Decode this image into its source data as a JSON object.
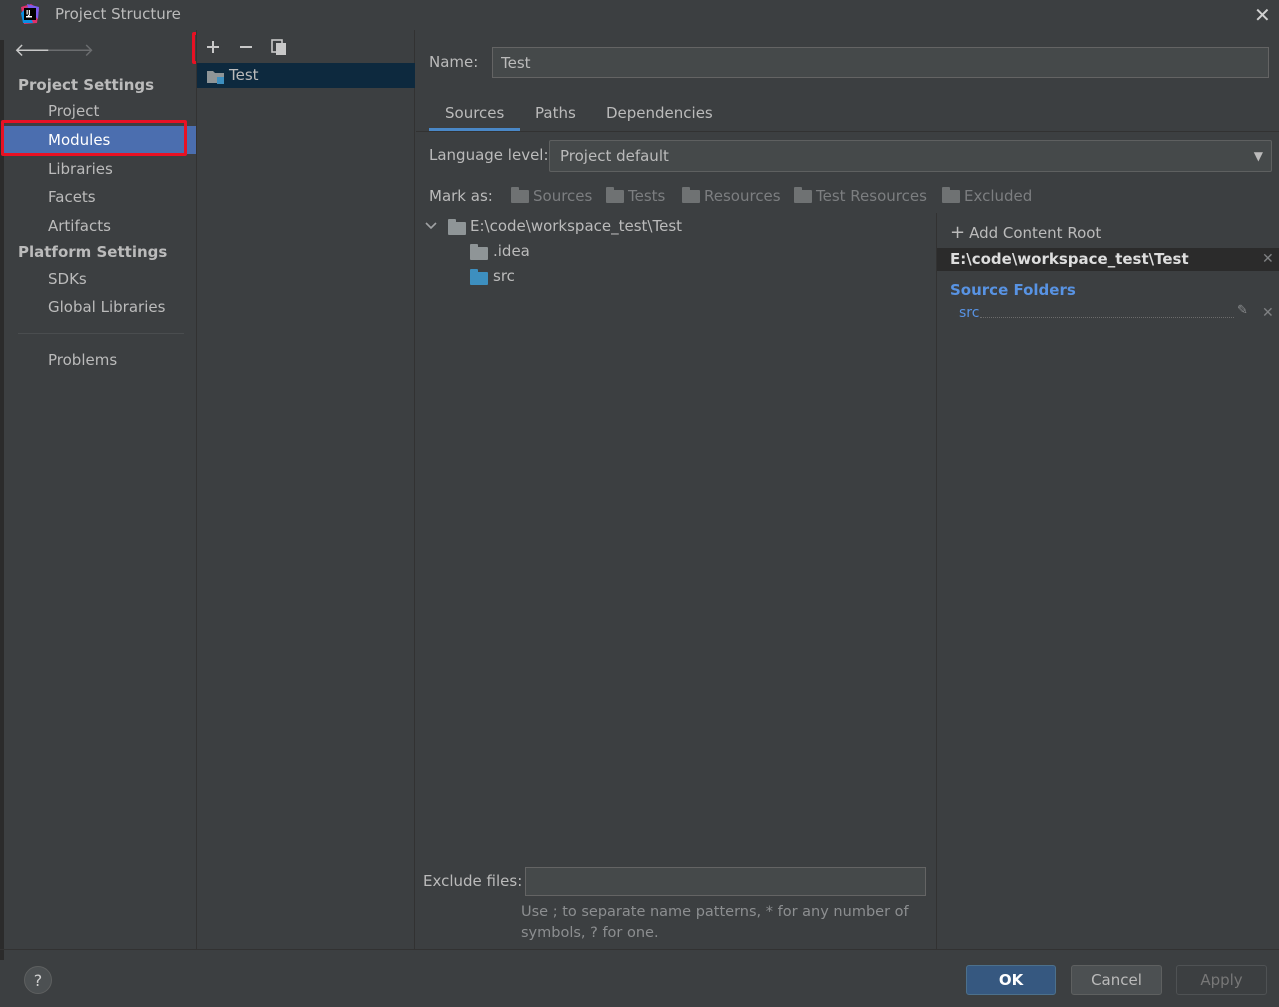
{
  "window": {
    "title": "Project Structure"
  },
  "sidebar": {
    "project_settings_title": "Project Settings",
    "project_items": [
      {
        "label": "Project"
      },
      {
        "label": "Modules"
      },
      {
        "label": "Libraries"
      },
      {
        "label": "Facets"
      },
      {
        "label": "Artifacts"
      }
    ],
    "platform_settings_title": "Platform Settings",
    "platform_items": [
      {
        "label": "SDKs"
      },
      {
        "label": "Global Libraries"
      }
    ],
    "problems": "Problems",
    "selected": "Modules"
  },
  "modules": {
    "list": [
      {
        "label": "Test"
      }
    ]
  },
  "module": {
    "name_label": "Name:",
    "name_value": "Test",
    "tabs": [
      {
        "label": "Sources"
      },
      {
        "label": "Paths"
      },
      {
        "label": "Dependencies"
      }
    ],
    "active_tab": "Sources",
    "language_level_label": "Language level:",
    "language_level_value": "Project default",
    "mark_as_label": "Mark as:",
    "mark_as": [
      {
        "label": "Sources"
      },
      {
        "label": "Tests"
      },
      {
        "label": "Resources"
      },
      {
        "label": "Test Resources"
      },
      {
        "label": "Excluded"
      }
    ],
    "tree": {
      "root": "E:\\code\\workspace_test\\Test",
      "children": [
        {
          "label": ".idea"
        },
        {
          "label": "src"
        }
      ]
    },
    "content_root": {
      "add_label": "Add Content Root",
      "path": "E:\\code\\workspace_test\\Test",
      "source_folders_title": "Source Folders",
      "source_folders": [
        {
          "label": "src"
        }
      ]
    },
    "exclude_files_label": "Exclude files:",
    "exclude_files_value": "",
    "hint": "Use ; to separate name patterns, * for any number of symbols, ? for one."
  },
  "buttons": {
    "help": "?",
    "ok": "OK",
    "cancel": "Cancel",
    "apply": "Apply"
  },
  "colors": {
    "background": "#3c3f41",
    "selection": "#4b6eaf",
    "accent_link": "#5893e3",
    "highlight_box": "#e81123",
    "ok_button": "#365880",
    "source_folder": "#3d8fbf",
    "plain_folder": "#8f9597"
  }
}
